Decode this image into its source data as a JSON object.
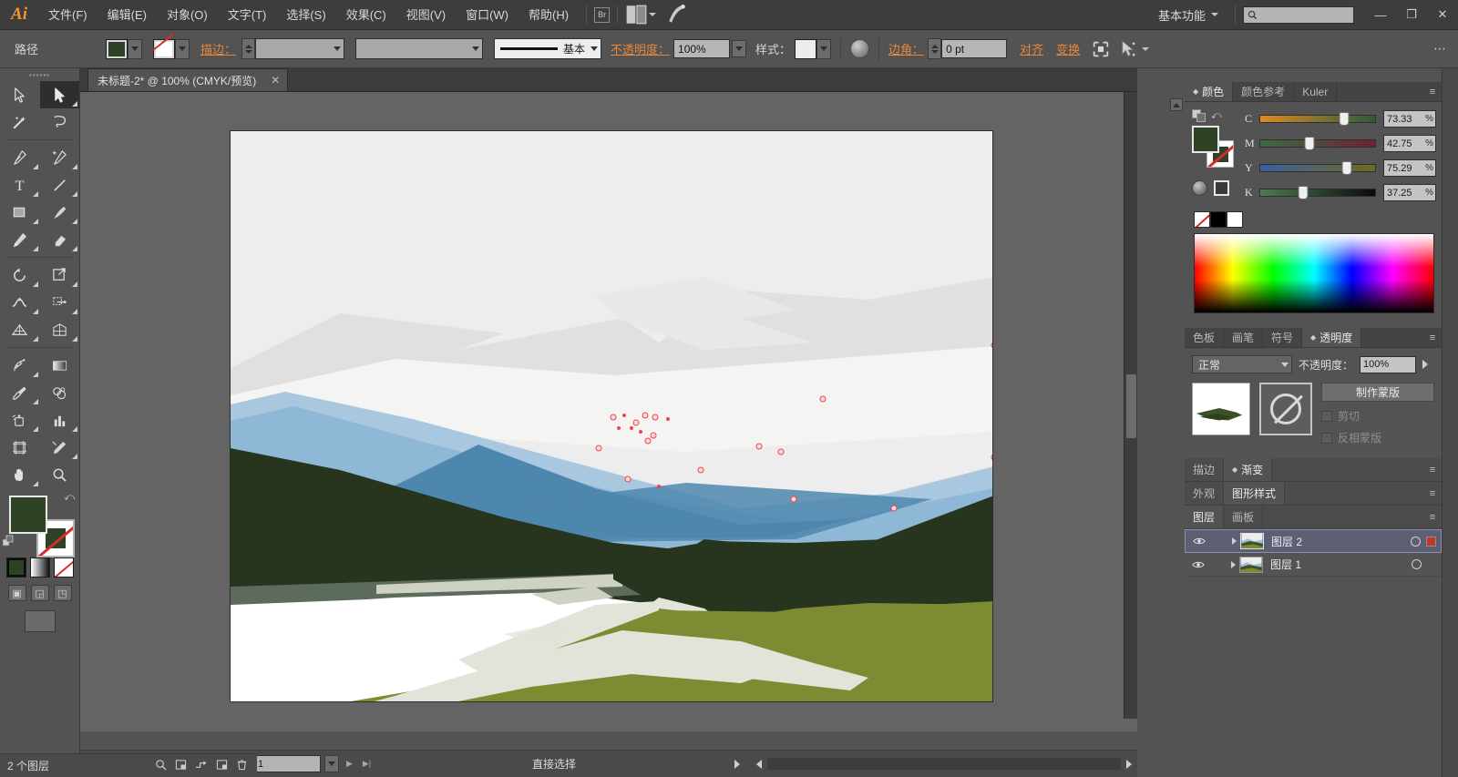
{
  "app": {
    "logo": "Ai",
    "menus": [
      {
        "label": "文件(F)"
      },
      {
        "label": "编辑(E)"
      },
      {
        "label": "对象(O)"
      },
      {
        "label": "文字(T)"
      },
      {
        "label": "选择(S)"
      },
      {
        "label": "效果(C)"
      },
      {
        "label": "视图(V)"
      },
      {
        "label": "窗口(W)"
      },
      {
        "label": "帮助(H)"
      }
    ],
    "bridge_label": "Br",
    "workspace": "基本功能",
    "search_placeholder": "",
    "search_value": "",
    "window": {
      "minimize": "—",
      "restore": "❐",
      "close": "✕"
    }
  },
  "control_bar": {
    "object_label": "路径",
    "fill_color": "#2e4226",
    "stroke_label": "描边：",
    "stroke_weight": "",
    "stroke_profile": "",
    "brush_label": "基本",
    "opacity_label": "不透明度：",
    "opacity_value": "100%",
    "style_label": "样式：",
    "corner_label": "边角：",
    "corner_value": "0 pt",
    "align_label": "对齐",
    "transform_label": "变换",
    "menu_dots": "⋯"
  },
  "toolbar": {
    "tools": [
      {
        "name": "selection-tool",
        "active": false
      },
      {
        "name": "direct-selection-tool",
        "active": true
      },
      {
        "name": "magic-wand-tool",
        "active": false
      },
      {
        "name": "lasso-tool",
        "active": false
      },
      {
        "name": "pen-tool",
        "active": false
      },
      {
        "name": "add-anchor-point-tool",
        "active": false
      },
      {
        "name": "type-tool",
        "active": false
      },
      {
        "name": "line-segment-tool",
        "active": false
      },
      {
        "name": "rectangle-tool",
        "active": false
      },
      {
        "name": "paintbrush-tool",
        "active": false
      },
      {
        "name": "pencil-tool",
        "active": false
      },
      {
        "name": "eraser-tool",
        "active": false
      },
      {
        "name": "rotate-tool",
        "active": false
      },
      {
        "name": "scale-tool",
        "active": false
      },
      {
        "name": "width-tool",
        "active": false
      },
      {
        "name": "free-transform-tool",
        "active": false
      },
      {
        "name": "shape-builder-tool",
        "active": false
      },
      {
        "name": "perspective-grid-tool",
        "active": false
      },
      {
        "name": "mesh-tool",
        "active": false
      },
      {
        "name": "gradient-tool",
        "active": false
      },
      {
        "name": "eyedropper-tool",
        "active": false
      },
      {
        "name": "blend-tool",
        "active": false
      },
      {
        "name": "symbol-sprayer-tool",
        "active": false
      },
      {
        "name": "column-graph-tool",
        "active": false
      },
      {
        "name": "artboard-tool",
        "active": false
      },
      {
        "name": "slice-tool",
        "active": false
      },
      {
        "name": "hand-tool",
        "active": false
      },
      {
        "name": "zoom-tool",
        "active": false
      }
    ],
    "fill_color": "#2e4226",
    "stroke_color": "none",
    "color_modes": [
      "color-mode-solid",
      "color-mode-gradient",
      "color-mode-none"
    ],
    "screen_modes": [
      "screen-mode-normal",
      "screen-mode-full-menu",
      "screen-mode-full"
    ]
  },
  "document": {
    "tab_title": "未标题-2* @ 100% (CMYK/预览)",
    "close_label": "✕"
  },
  "status_bar": {
    "zoom": "100%",
    "page": "1",
    "tool_status": "直接选择"
  },
  "panels": {
    "color": {
      "tabs": [
        {
          "label": "颜色",
          "active": true,
          "has_dbl": true
        },
        {
          "label": "颜色参考",
          "active": false,
          "has_dbl": false
        },
        {
          "label": "Kuler",
          "active": false,
          "has_dbl": false
        }
      ],
      "menu_icon": "≡",
      "mode": "CMYK",
      "fill_color": "#2e4226",
      "channels": [
        {
          "label": "C",
          "value": "73.33",
          "unit": "%",
          "pct": 73.33,
          "track": "linear-gradient(to right,#e08a20,#2b5c3a)"
        },
        {
          "label": "M",
          "value": "42.75",
          "unit": "%",
          "pct": 42.75,
          "track": "linear-gradient(to right,#3a6b46,#6e2230)"
        },
        {
          "label": "Y",
          "value": "75.29",
          "unit": "%",
          "pct": 75.29,
          "track": "linear-gradient(to right,#3a5f9e,#6e6a20)"
        },
        {
          "label": "K",
          "value": "37.25",
          "unit": "%",
          "pct": 37.25,
          "track": "linear-gradient(to right,#4f7a54,#0a0a0a)"
        }
      ],
      "quick_swatches": [
        "none",
        "black",
        "white"
      ]
    },
    "transparency": {
      "tabs": [
        {
          "label": "色板",
          "active": false,
          "has_dbl": false
        },
        {
          "label": "画笔",
          "active": false,
          "has_dbl": false
        },
        {
          "label": "符号",
          "active": false,
          "has_dbl": false
        },
        {
          "label": "透明度",
          "active": true,
          "has_dbl": true
        }
      ],
      "menu_icon": "≡",
      "blend_mode": "正常",
      "opacity_label": "不透明度：",
      "opacity_value": "100%",
      "make_mask_label": "制作蒙版",
      "clip_label": "剪切",
      "invert_label": "反相蒙版"
    },
    "stroke_gradient": {
      "tabs": [
        {
          "label": "描边",
          "active": false,
          "has_dbl": false
        },
        {
          "label": "渐变",
          "active": true,
          "has_dbl": true
        }
      ],
      "menu_icon": "≡"
    },
    "appearance": {
      "tabs": [
        {
          "label": "外观",
          "active": false,
          "has_dbl": false
        },
        {
          "label": "图形样式",
          "active": true,
          "has_dbl": false
        }
      ],
      "menu_icon": "≡"
    },
    "layers": {
      "tabs": [
        {
          "label": "图层",
          "active": true,
          "has_dbl": false
        },
        {
          "label": "画板",
          "active": false,
          "has_dbl": false
        }
      ],
      "menu_icon": "≡",
      "rows": [
        {
          "name": "图层 2",
          "selected": true,
          "visible": true,
          "has_target_square": true
        },
        {
          "name": "图层 1",
          "selected": false,
          "visible": true,
          "has_target_square": false
        }
      ],
      "footer_text": "2 个图层",
      "footer_icons": [
        "search-icon",
        "new-sublayer-icon",
        "make-clipping-mask-icon",
        "new-layer-icon",
        "delete-layer-icon"
      ]
    }
  },
  "artwork": {
    "title": "Vector landscape illustration",
    "colors": {
      "sky": "#ededee",
      "cloud_light": "#e3e3e3",
      "cloud_soft": "#f3f3f2",
      "mountain_light_blue": "#a8c6de",
      "mountain_mid_blue": "#8bb4d4",
      "mountain_dark_blue": "#4e87ae",
      "hill_dark_green": "#27351f",
      "hill_green_shadow": "#2e4226",
      "field_olive": "#7d8c33",
      "path_white": "#ffffff",
      "path_cream": "#e2e4da",
      "rock_gray": "#5d6b5d"
    },
    "selected_path_anchors": 22
  }
}
